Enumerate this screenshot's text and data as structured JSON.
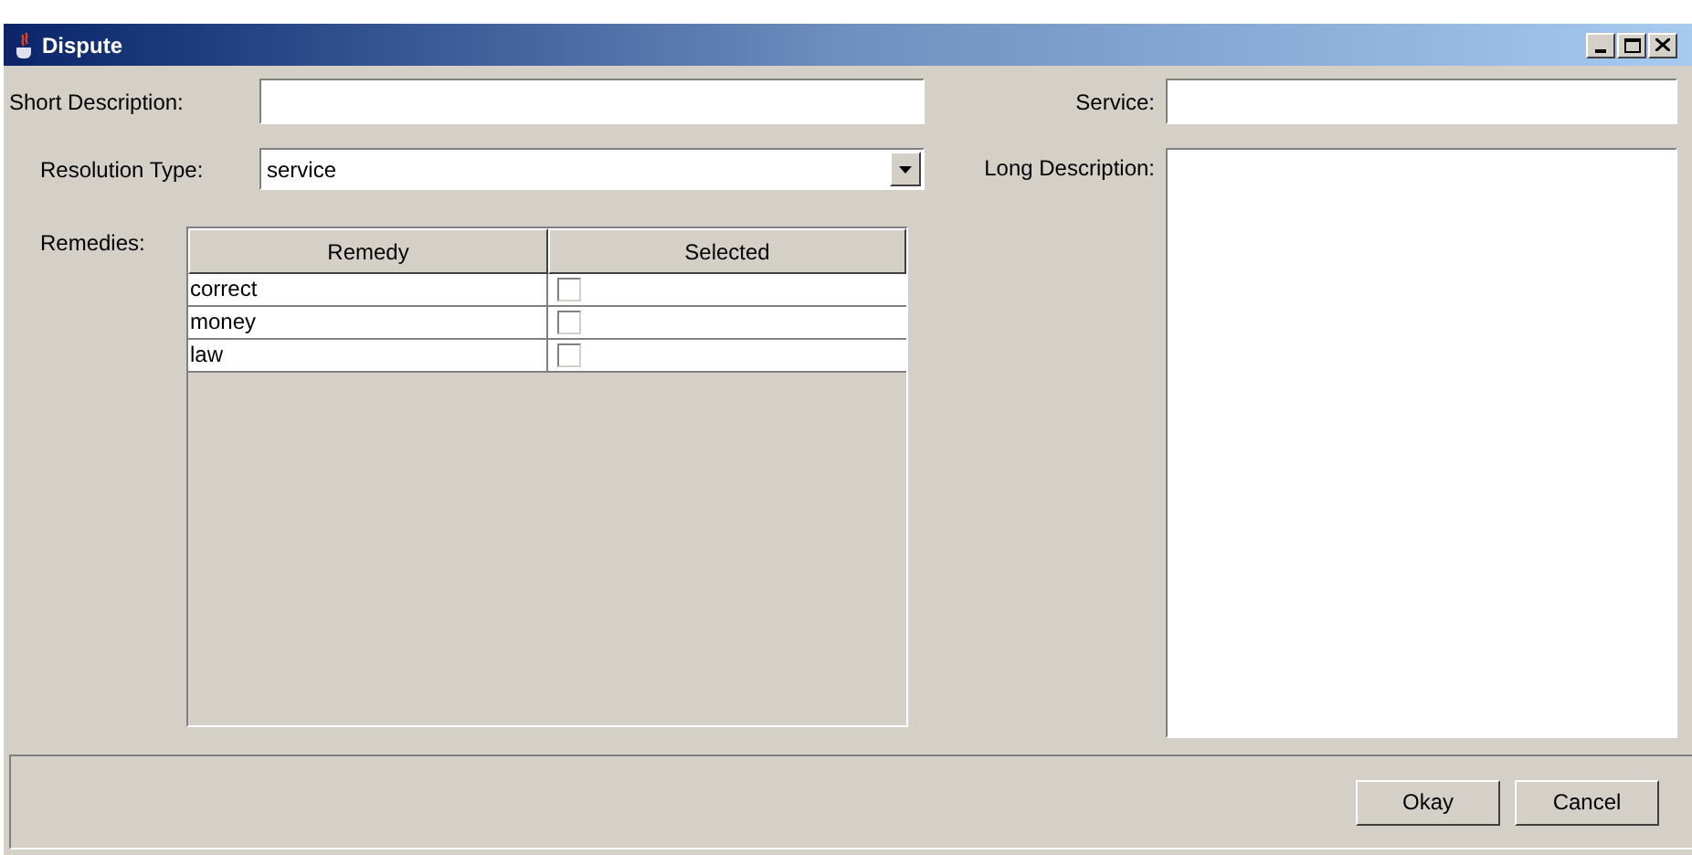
{
  "window": {
    "title": "Dispute"
  },
  "short_description": {
    "label": "Short Description:"
  },
  "resolution_type": {
    "label": "Resolution Type:",
    "value": "service"
  },
  "remedies": {
    "label": "Remedies:",
    "columns": [
      "Remedy",
      "Selected"
    ],
    "rows": [
      {
        "remedy": "correct",
        "checked": false
      },
      {
        "remedy": "money",
        "checked": false
      },
      {
        "remedy": "law",
        "checked": false
      }
    ]
  },
  "service": {
    "label": "Service:"
  },
  "long_description": {
    "label": "Long Description:"
  },
  "buttons": [
    "Okay",
    "Cancel"
  ]
}
